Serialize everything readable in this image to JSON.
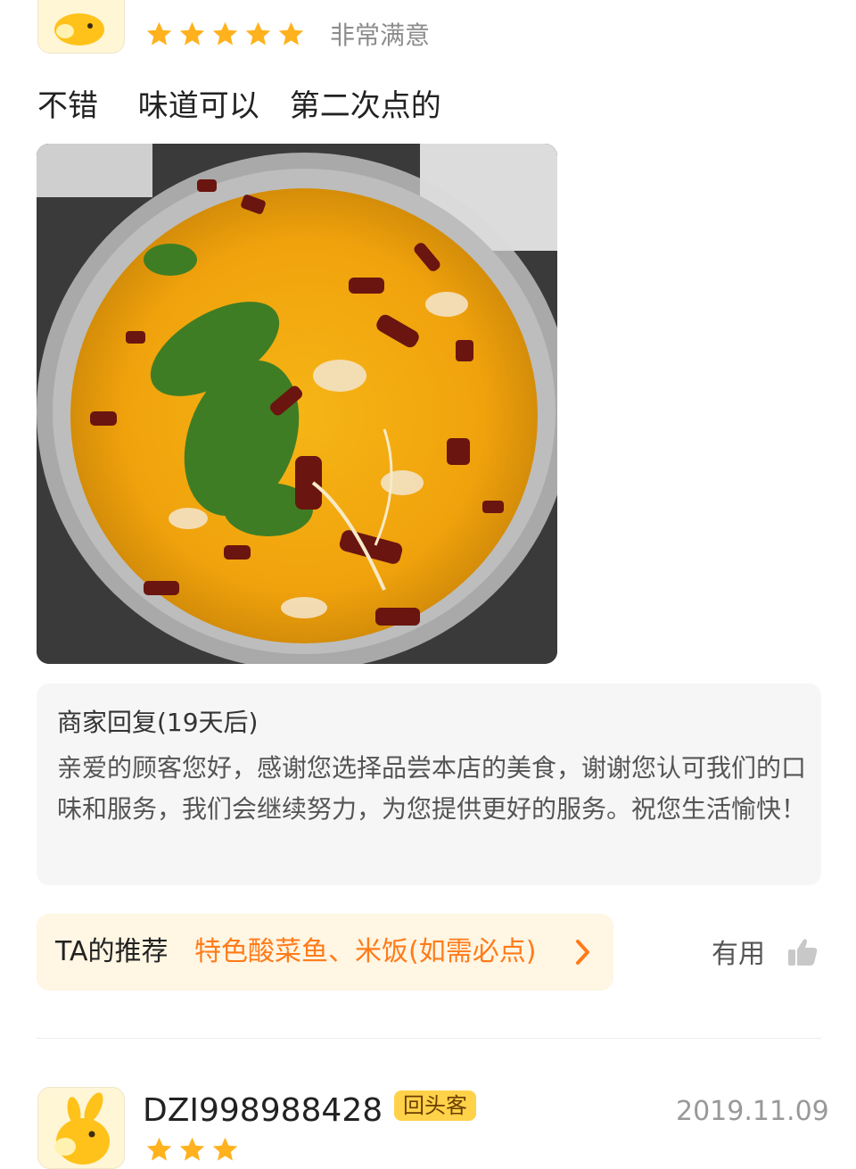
{
  "review": {
    "rating_text": "非常满意",
    "stars": 5,
    "text": "不错　 味道可以　第二次点的",
    "photo_icon": "food-photo-sour-fish-soup"
  },
  "merchant_reply": {
    "title": "商家回复(19天后)",
    "body": "亲爱的顾客您好，感谢您选择品尝本店的美食，谢谢您认可我们的口味和服务，我们会继续努力，为您提供更好的服务。祝您生活愉快！"
  },
  "recommendation": {
    "label": "TA的推荐",
    "value": "特色酸菜鱼、米饭(如需必点)",
    "chevron_icon": "chevron-right-icon"
  },
  "useful": {
    "label": "有用",
    "icon": "thumbs-up-icon"
  },
  "next_review": {
    "username": "DZI998988428",
    "badge": "回头客",
    "date": "2019.11.09"
  },
  "colors": {
    "star": "#ffb21e",
    "accent_orange": "#ff7b1a",
    "badge_bg": "#ffd24a",
    "reply_bg": "#f6f6f6",
    "rec_bg": "#fff6e3"
  }
}
